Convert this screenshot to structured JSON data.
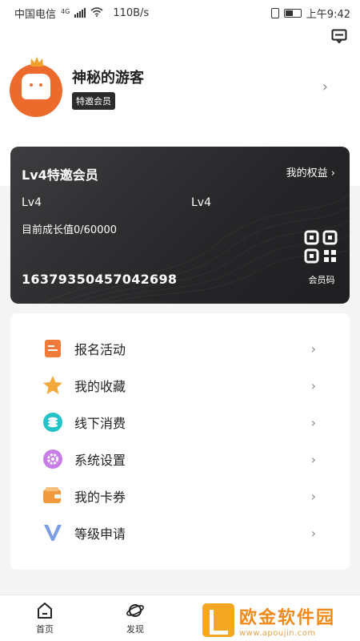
{
  "status_bar": {
    "carrier": "中国电信",
    "network": "4G",
    "speed": "110B/s",
    "time": "上午9:42"
  },
  "header": {
    "message_icon": "message-icon"
  },
  "profile": {
    "username": "神秘的游客",
    "badge": "特邀会员",
    "avatar_color": "#ec6a2c"
  },
  "card": {
    "title": "Lv4特邀会员",
    "benefits_link": "我的权益",
    "level_left": "Lv4",
    "level_right": "Lv4",
    "growth": "目前成长值0/60000",
    "member_number": "16379350457042698",
    "qr_label": "会员码"
  },
  "menu": {
    "items": [
      {
        "label": "报名活动",
        "icon": "signup-icon",
        "color": "#f07a3a"
      },
      {
        "label": "我的收藏",
        "icon": "star-icon",
        "color": "#f3a83b"
      },
      {
        "label": "线下消费",
        "icon": "coin-stack-icon",
        "color": "#25c3c8"
      },
      {
        "label": "系统设置",
        "icon": "settings-icon",
        "color": "#c77ce8"
      },
      {
        "label": "我的卡券",
        "icon": "wallet-icon",
        "color": "#f29a3c"
      },
      {
        "label": "等级申请",
        "icon": "v-level-icon",
        "color": "#7d9ee6"
      }
    ]
  },
  "tabbar": {
    "tabs": [
      {
        "label": "首页",
        "icon": "home-icon"
      },
      {
        "label": "发现",
        "icon": "planet-icon"
      }
    ]
  },
  "watermark": {
    "title": "欧金软件园",
    "url": "www.apoujin.com"
  }
}
